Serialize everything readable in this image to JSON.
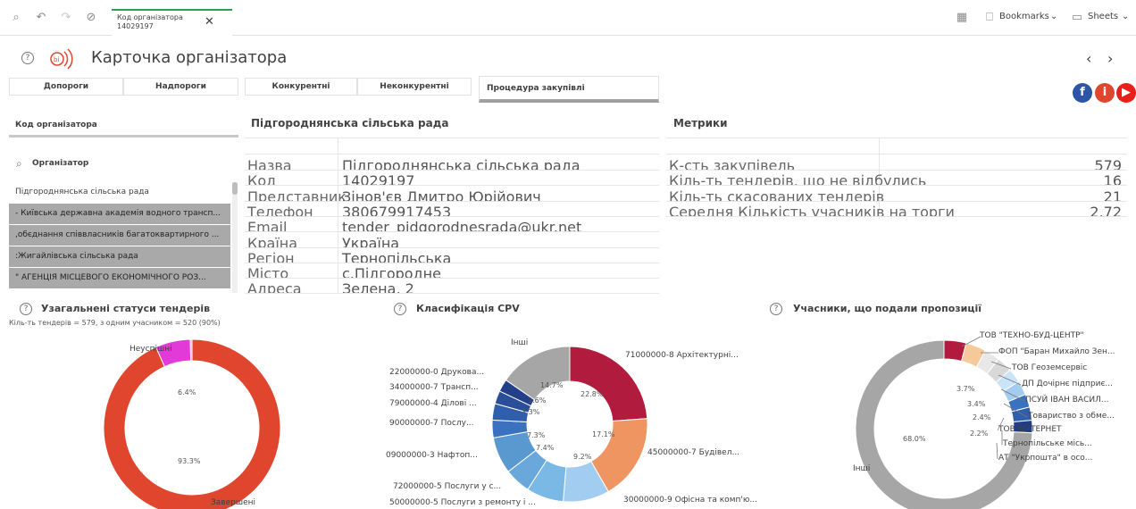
{
  "toolbar": {
    "selection_title": "Код організатора",
    "selection_value": "14029197",
    "bookmarks": "Bookmarks",
    "sheets": "Sheets"
  },
  "sheet": {
    "title": "Карточка організатора"
  },
  "tabs": [
    "Допороги",
    "Надпороги",
    "Конкурентні",
    "Неконкурентні",
    "Процедура закупівлі"
  ],
  "filters": {
    "code_label": "Код організатора",
    "org_label": "Організатор",
    "org_items": [
      "Підгороднянська сільська рада",
      "- Київська державна академія водного трансп...",
      ",обєднання співвласників багатоквартирного ...",
      ":Жигайлівська сільська рада",
      "\" АГЕНЦІЯ МІСЦЕВОГО ЕКОНОМІЧНОГО РОЗ..."
    ]
  },
  "org_table": {
    "title": "Підгороднянська сільська рада",
    "rows": [
      {
        "k": "Назва",
        "v": "Підгороднянська сільська рада"
      },
      {
        "k": "Код",
        "v": "14029197"
      },
      {
        "k": "Представник",
        "v": "Зінов'єв Дмитро Юрійович"
      },
      {
        "k": "Телефон",
        "v": "380679917453"
      },
      {
        "k": "Email",
        "v": "tender_pidgorodnesrada@ukr.net"
      },
      {
        "k": "Країна",
        "v": "Україна"
      },
      {
        "k": "Регіон",
        "v": "Тернопільська"
      },
      {
        "k": "Місто",
        "v": "с.Підгородне"
      },
      {
        "k": "Адреса",
        "v": "Зелена, 2"
      }
    ]
  },
  "metrics": {
    "title": "Метрики",
    "rows": [
      {
        "k": "К-сть закупівель",
        "v": "579"
      },
      {
        "k": "Кіль-ть тендерів, що не відбулись",
        "v": "16"
      },
      {
        "k": "Кіль-ть скасованих тендерів",
        "v": "21"
      },
      {
        "k": "Середня Кількість учасників на торги",
        "v": "2,72"
      }
    ]
  },
  "charts_text": {
    "status_title": "Узагальнені статуси тендерів",
    "status_sub": "Кіль-ть тендерів = 579, з одним учасником = 520 (90%)",
    "cpv_title": "Класифікація CPV",
    "part_title": "Учасники, що подали пропозиції"
  },
  "chart_data": [
    {
      "type": "pie",
      "title": "Узагальнені статуси тендерів",
      "slices": [
        {
          "label": "Завершені",
          "value": 93.3,
          "color": "#e0452e"
        },
        {
          "label": "Неуспішні",
          "value": 6.4,
          "color": "#e23ad8"
        },
        {
          "label": "",
          "value": 0.3,
          "color": "#f0a0b0"
        }
      ],
      "pct_labels": [
        "6.4%",
        "93.3%"
      ]
    },
    {
      "type": "pie",
      "title": "Класифікація CPV",
      "slices": [
        {
          "label": "71000000-8 Архітектурні...",
          "value": 22.8,
          "color": "#b11c3e"
        },
        {
          "label": "45000000-7 Будівел...",
          "value": 17.1,
          "color": "#ef9562"
        },
        {
          "label": "30000000-9 Офісна та комп'ю...",
          "value": 9.2,
          "color": "#a3cdf0"
        },
        {
          "label": "50000000-5 Послуги з ремонту і ...",
          "value": 7.4,
          "color": "#7ab8e6"
        },
        {
          "label": "72000000-5 Послуги у с...",
          "value": 5.2,
          "color": "#6aa8dc"
        },
        {
          "label": "09000000-3 Нафтоп...",
          "value": 7.3,
          "color": "#5a98d0"
        },
        {
          "label": "90000000-7 Послу...",
          "value": 3.5,
          "color": "#3b72bf"
        },
        {
          "label": "79000000-4 Ділові ...",
          "value": 3.3,
          "color": "#2f5ead"
        },
        {
          "label": "34000000-7 Трансп...",
          "value": 2.6,
          "color": "#2a4e9a"
        },
        {
          "label": "22000000-0 Друкова...",
          "value": 2.5,
          "color": "#233f8a"
        },
        {
          "label": "Інші",
          "value": 14.7,
          "color": "#a6a6a6"
        }
      ],
      "pct_labels": [
        "22.8%",
        "17.1%",
        "9.2%",
        "7.4%",
        "7.3%",
        "3.3%",
        "2.6%",
        "14.7%"
      ]
    },
    {
      "type": "pie",
      "title": "Учасники, що подали пропозиції",
      "slices": [
        {
          "label": "ТОВ \"ТЕХНО-БУД-ЦЕНТР\"",
          "value": 3.7,
          "color": "#b11c3e"
        },
        {
          "label": "ФОП \"Баран Михайло Зен...",
          "value": 3.4,
          "color": "#f5c99a"
        },
        {
          "label": "ТОВ Геоземсервіс",
          "value": 2.6,
          "color": "#e8e8e8"
        },
        {
          "label": "ДП Дочірнє підприє...",
          "value": 2.6,
          "color": "#d8d8d8"
        },
        {
          "label": "ПСУЙ ІВАН ВАСИЛ...",
          "value": 2.4,
          "color": "#c9e3f7"
        },
        {
          "label": "Товариство з обме...",
          "value": 2.4,
          "color": "#a3cdf0"
        },
        {
          "label": "ТОВ БІТТЕРНЕТ",
          "value": 2.2,
          "color": "#3b72bf"
        },
        {
          "label": "Тернопільське місь...",
          "value": 2.2,
          "color": "#2f5ead"
        },
        {
          "label": "АТ \"Укрпошта\" в осо...",
          "value": 2.1,
          "color": "#223d86"
        },
        {
          "label": "Інші",
          "value": 68.0,
          "color": "#a6a6a6"
        }
      ],
      "pct_labels": [
        "3.7%",
        "3.4%",
        "2.4%",
        "2.2%",
        "68.0%"
      ]
    }
  ]
}
